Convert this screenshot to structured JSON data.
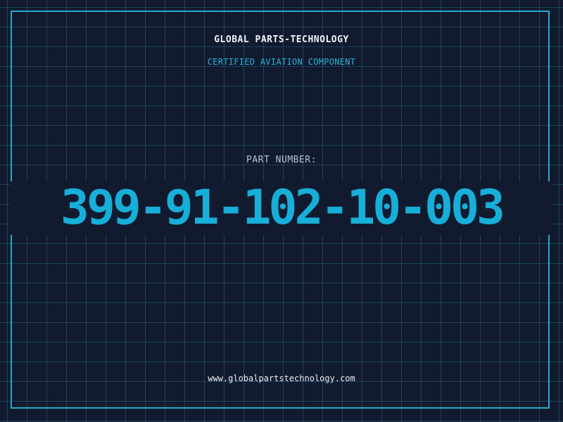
{
  "header": {
    "company": "GLOBAL PARTS-TECHNOLOGY",
    "subtitle": "CERTIFIED AVIATION COMPONENT"
  },
  "part": {
    "label": "PART NUMBER:",
    "number": "399-91-102-10-003"
  },
  "footer": {
    "url": "www.globalpartstechnology.com"
  },
  "colors": {
    "background": "#111a2e",
    "grid": "#287896",
    "frame": "#27a9cc",
    "accent": "#17aed8",
    "label": "#b8c2cf",
    "text": "#f2f4f7"
  }
}
